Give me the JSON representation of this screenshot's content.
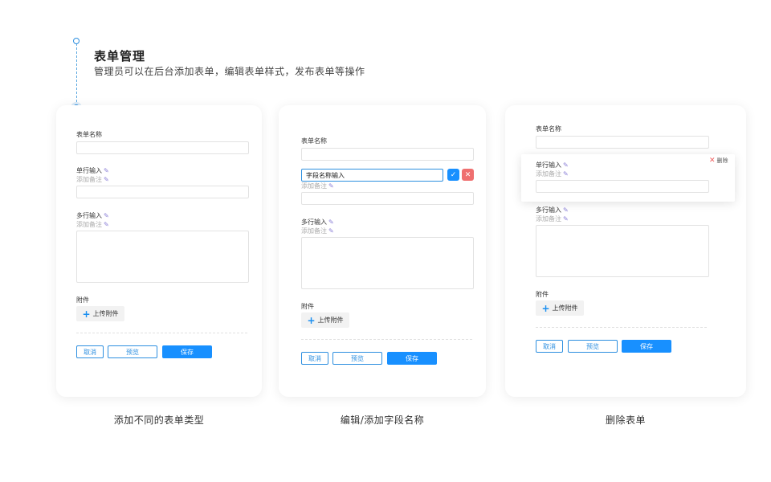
{
  "header": {
    "title": "表单管理",
    "description": "管理员可以在后台添加表单，编辑表单样式，发布表单等操作"
  },
  "form": {
    "form_name_label": "表单名称",
    "single_line_label": "单行输入",
    "multi_line_label": "多行输入",
    "add_note_label": "添加备注",
    "attachment_label": "附件",
    "upload_label": "上传附件",
    "cancel_label": "取消",
    "preview_label": "预览",
    "save_label": "保存"
  },
  "edit": {
    "field_name_value": "字段名称输入"
  },
  "delete": {
    "delete_label": "删除"
  },
  "captions": {
    "card1": "添加不同的表单类型",
    "card2": "编辑/添加字段名称",
    "card3": "删除表单"
  },
  "icons": {
    "edit": "pencil-icon",
    "add": "plus-icon",
    "confirm": "check-icon",
    "close": "close-icon"
  },
  "colors": {
    "accent": "#1890ff",
    "danger": "#ef6f6f",
    "edit_icon": "#8a7fd6"
  }
}
